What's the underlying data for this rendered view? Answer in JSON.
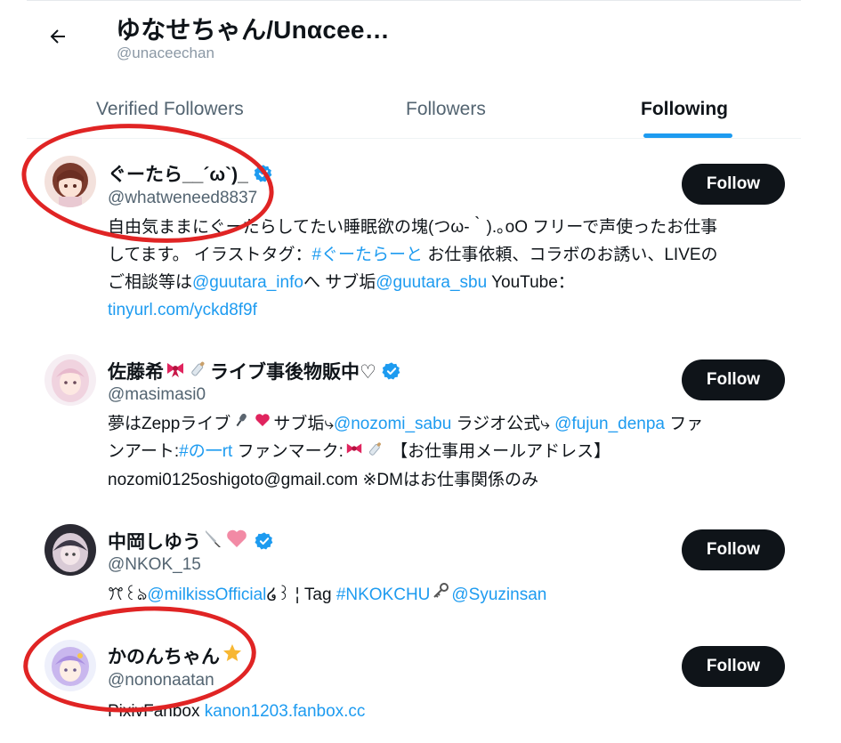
{
  "header": {
    "title": "ゆなせちゃん/Unαcee…",
    "handle": "@unaceechan"
  },
  "tabs": [
    {
      "label": "Verified Followers"
    },
    {
      "label": "Followers"
    },
    {
      "label": "Following",
      "active": true
    }
  ],
  "users": [
    {
      "name": "ぐーたら__´ω`)_",
      "handle": "@whatweneed8837",
      "verified": true,
      "follow_label": "Follow",
      "bio": {
        "line1": "自由気ままにぐーたらしてたい睡眠欲の塊(つω-｀).｡oO フリーで声使ったお仕事",
        "line2a": "してます。 イラストタグ：",
        "line2_link": "#ぐーたらーと",
        "line2b": " お仕事依頼、コラボのお誘い、LIVEの",
        "line3a": "ご相談等は",
        "line3_link1": "@guutara_info",
        "line3b": "へ サブ垢",
        "line3_link2": "@guutara_sbu",
        "line3c": " YouTube：",
        "line4_link": "tinyurl.com/yckd8f9f"
      }
    },
    {
      "name_a": "佐藤希",
      "name_b": "ライブ事後物販中♡",
      "handle": "@masimasi0",
      "verified": true,
      "follow_label": "Follow",
      "bio": {
        "line1a": "夢はZeppライブ",
        "line1b": "サブ垢⤷",
        "line1_link1": "@nozomi_sabu",
        "line1c": " ラジオ公式⤷ ",
        "line1_link2": "@fujun_denpa",
        "line1d": " ファ",
        "line2a": "ンアート:",
        "line2_link": "#の一rt",
        "line2b": " ファンマーク:",
        "line2c": " 【お仕事用メールアドレス】",
        "line3": "nozomi0125oshigoto@gmail.com ※DMはお仕事関係のみ"
      }
    },
    {
      "name": "中岡しゆう",
      "handle": "@NKOK_15",
      "verified": true,
      "follow_label": "Follow",
      "bio": {
        "a": "ꔫ꒰ঌ",
        "link1": "@milkissOfficial",
        "b": "໒꒱ ¦ Tag ",
        "link2": "#NKOKCHU",
        "link3": "@Syuzinsan"
      }
    },
    {
      "name": "かのんちゃん",
      "handle": "@nononaatan",
      "verified": false,
      "follow_label": "Follow",
      "bio": {
        "a": "PixivFanbox ",
        "link": "kanon1203.fanbox.cc"
      }
    }
  ],
  "colors": {
    "accent": "#1d9bf0",
    "button_bg": "#0f1419",
    "annotation": "#e02424"
  },
  "icons": [
    "back-arrow-icon",
    "verified-badge-icon",
    "ribbon-emoji",
    "baby-bottle-emoji",
    "microphone-emoji",
    "hearts-emoji",
    "knife-emoji",
    "pink-heart-emoji",
    "key-emoji",
    "star-emoji"
  ]
}
